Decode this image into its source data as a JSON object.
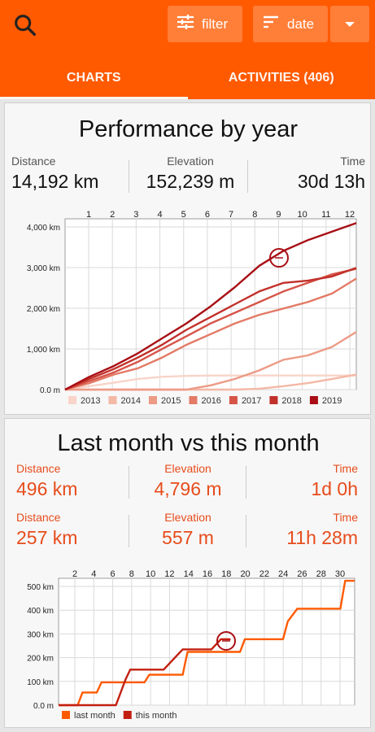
{
  "header": {
    "filter_label": "filter",
    "sort_label": "date",
    "tabs": [
      {
        "label": "CHARTS",
        "active": true
      },
      {
        "label": "ACTIVITIES (406)",
        "active": false
      }
    ]
  },
  "colors": {
    "accent": "#ff5a00"
  },
  "card1": {
    "title": "Performance by year",
    "stats": [
      {
        "label": "Distance",
        "value": "14,192 km"
      },
      {
        "label": "Elevation",
        "value": "152,239 m"
      },
      {
        "label": "Time",
        "value": "30d 13h"
      }
    ]
  },
  "card2": {
    "title": "Last month vs this month",
    "row1": [
      {
        "label": "Distance",
        "value": "496 km"
      },
      {
        "label": "Elevation",
        "value": "4,796 m"
      },
      {
        "label": "Time",
        "value": "1d 0h"
      }
    ],
    "row2": [
      {
        "label": "Distance",
        "value": "257 km"
      },
      {
        "label": "Elevation",
        "value": "557 m"
      },
      {
        "label": "Time",
        "value": "11h 28m"
      }
    ]
  },
  "chart_data": [
    {
      "type": "line",
      "x_top_labels": [
        "1",
        "2",
        "3",
        "4",
        "5",
        "6",
        "7",
        "8",
        "9",
        "10",
        "11",
        "12"
      ],
      "y_ticks": [
        "4,000 km",
        "3,000 km",
        "2,000 km",
        "1,000 km",
        "0.0 m"
      ],
      "ylim": [
        0,
        4000
      ],
      "xlim": [
        0,
        12
      ],
      "grid": true,
      "legend_position": "bottom",
      "series": [
        {
          "name": "2013",
          "color": "#f8d4c8",
          "x": [
            0,
            1,
            2,
            3,
            4,
            5,
            6,
            7,
            8,
            9,
            10,
            11,
            12
          ],
          "values": [
            0,
            80,
            160,
            250,
            300,
            320,
            330,
            330,
            330,
            330,
            330,
            330,
            330
          ]
        },
        {
          "name": "2014",
          "color": "#f4b8a6",
          "x": [
            0,
            1,
            2,
            3,
            4,
            5,
            6,
            7,
            8,
            9,
            10,
            11,
            12
          ],
          "values": [
            0,
            0,
            0,
            0,
            0,
            0,
            0,
            0,
            20,
            80,
            150,
            250,
            350
          ]
        },
        {
          "name": "2015",
          "color": "#ec9a86",
          "x": [
            0,
            1,
            2,
            3,
            4,
            5,
            6,
            7,
            8,
            9,
            10,
            11,
            12
          ],
          "values": [
            0,
            0,
            0,
            0,
            0,
            0,
            100,
            250,
            450,
            700,
            800,
            1000,
            1350
          ]
        },
        {
          "name": "2016",
          "color": "#e37a66",
          "x": [
            0,
            1,
            2,
            3,
            4,
            5,
            6,
            7,
            8,
            9,
            10,
            11,
            12
          ],
          "values": [
            0,
            150,
            350,
            500,
            750,
            1050,
            1300,
            1550,
            1750,
            1900,
            2050,
            2250,
            2600
          ]
        },
        {
          "name": "2017",
          "color": "#d65448",
          "x": [
            0,
            1,
            2,
            3,
            4,
            5,
            6,
            7,
            8,
            9,
            10,
            11,
            12
          ],
          "values": [
            0,
            200,
            400,
            650,
            950,
            1250,
            1550,
            1800,
            2050,
            2300,
            2500,
            2700,
            2830
          ]
        },
        {
          "name": "2018",
          "color": "#c2302a",
          "x": [
            0,
            1,
            2,
            3,
            4,
            5,
            6,
            7,
            8,
            9,
            10,
            11,
            12
          ],
          "values": [
            0,
            250,
            480,
            750,
            1050,
            1400,
            1700,
            2000,
            2300,
            2500,
            2550,
            2650,
            2850
          ]
        },
        {
          "name": "2019",
          "color": "#a80e14",
          "x": [
            0,
            1,
            2,
            3,
            4,
            5,
            6,
            7,
            8,
            9,
            10,
            11,
            12
          ],
          "values": [
            0,
            300,
            550,
            850,
            1200,
            1550,
            1950,
            2400,
            2900,
            3250,
            3500,
            3700,
            3900
          ]
        }
      ]
    },
    {
      "type": "line",
      "x_top_labels": [
        "2",
        "4",
        "6",
        "8",
        "10",
        "12",
        "14",
        "16",
        "18",
        "20",
        "22",
        "24",
        "26",
        "28",
        "30"
      ],
      "y_ticks": [
        "500 km",
        "400 km",
        "300 km",
        "200 km",
        "100 km",
        "0.0 m"
      ],
      "ylim": [
        0,
        500
      ],
      "xlim": [
        0,
        31
      ],
      "grid": true,
      "legend_position": "bottom",
      "series": [
        {
          "name": "last month",
          "color": "#ff5a00",
          "x": [
            0,
            2,
            2.5,
            4,
            4.5,
            9,
            9.5,
            13,
            13.5,
            19,
            19.5,
            22,
            23.5,
            24,
            25,
            28,
            29.5,
            30,
            31
          ],
          "values": [
            0,
            0,
            50,
            50,
            90,
            90,
            120,
            120,
            210,
            210,
            260,
            260,
            260,
            330,
            380,
            380,
            380,
            490,
            490
          ]
        },
        {
          "name": "this month",
          "color": "#c21f10",
          "x": [
            0,
            6,
            7,
            7.5,
            11,
            12,
            13,
            14,
            15,
            16,
            17,
            18
          ],
          "values": [
            0,
            0,
            100,
            140,
            140,
            180,
            220,
            220,
            220,
            220,
            260,
            260
          ]
        }
      ]
    }
  ]
}
